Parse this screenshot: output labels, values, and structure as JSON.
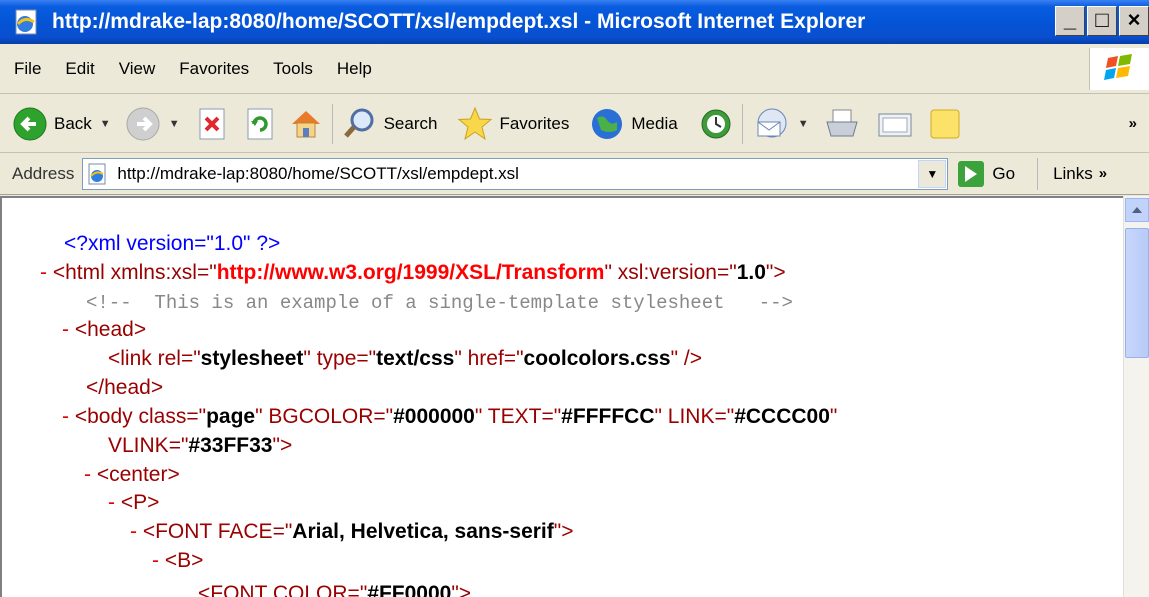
{
  "window": {
    "title": "http://mdrake-lap:8080/home/SCOTT/xsl/empdept.xsl - Microsoft Internet Explorer",
    "buttons": {
      "minimize": "_",
      "maximize": "□",
      "close": "×"
    }
  },
  "menu": {
    "items": [
      "File",
      "Edit",
      "View",
      "Favorites",
      "Tools",
      "Help"
    ]
  },
  "toolbar": {
    "back_label": "Back",
    "search_label": "Search",
    "favorites_label": "Favorites",
    "media_label": "Media",
    "overflow": "»"
  },
  "address": {
    "label": "Address",
    "url": "http://mdrake-lap:8080/home/SCOTT/xsl/empdept.xsl",
    "go_label": "Go",
    "links_label": "Links",
    "overflow": "»"
  },
  "xml": {
    "l1": "<?xml version=\"1.0\" ?>",
    "l2_minus": "-",
    "l2_open": "<html ",
    "l2_a1": "xmlns:xsl=\"",
    "l2_v1": "http://www.w3.org/1999/XSL/Transform",
    "l2_q1": "\" ",
    "l2_a2": "xsl:version=\"",
    "l2_v2": "1.0",
    "l2_end": "\">",
    "l3": "<!--  This is an example of a single-template stylesheet   -->",
    "l4_minus": "-",
    "l4_tag": "<head>",
    "l5_open": "<link ",
    "l5_a1": "rel=\"",
    "l5_v1": "stylesheet",
    "l5_a2": "\" type=\"",
    "l5_v2": "text/css",
    "l5_a3": "\" href=\"",
    "l5_v3": "coolcolors.css",
    "l5_end": "\" />",
    "l6_tag": "</head>",
    "l7_minus": "-",
    "l7_open": "<body ",
    "l7_a1": "class=\"",
    "l7_v1": "page",
    "l7_a2": "\" BGCOLOR=\"",
    "l7_v2": "#000000",
    "l7_a3": "\" TEXT=\"",
    "l7_v3": "#FFFFCC",
    "l7_a4": "\" LINK=\"",
    "l7_v4": "#CCCC00",
    "l7_q": "\"",
    "l8_a": "VLINK=\"",
    "l8_v": "#33FF33",
    "l8_end": "\">",
    "l9_minus": "-",
    "l9_tag": "<center>",
    "l10_minus": "-",
    "l10_tag": "<P>",
    "l11_minus": "-",
    "l11_open": "<FONT ",
    "l11_a": "FACE=\"",
    "l11_v": "Arial, Helvetica, sans-serif",
    "l11_end": "\">",
    "l12_minus": "-",
    "l12_tag": "<B>",
    "l13_open": "<FONT ",
    "l13_a": "COLOR=\"",
    "l13_v": "#FF0000",
    "l13_end": "\">"
  }
}
